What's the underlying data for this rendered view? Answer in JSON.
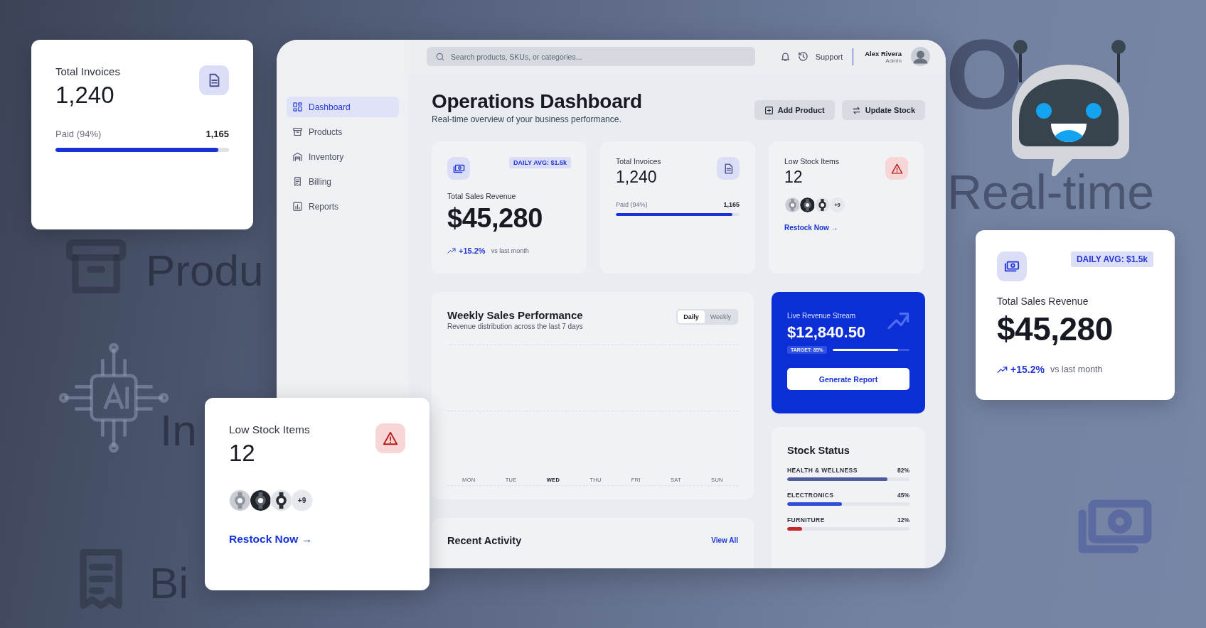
{
  "background_words": [
    {
      "text": "Produ"
    },
    {
      "text": "In"
    },
    {
      "text": "Bi"
    },
    {
      "text": "O"
    },
    {
      "text": "Real-time"
    }
  ],
  "dashboard": {
    "topbar": {
      "search": {
        "placeholder": "Search products, SKUs, or categories..."
      },
      "support": "Support",
      "user": {
        "name": "Alex Rivera",
        "role": "Admin"
      }
    },
    "sidebar": {
      "items": [
        {
          "label": "Dashboard",
          "selected": true
        },
        {
          "label": "Products",
          "selected": false
        },
        {
          "label": "Inventory",
          "selected": false
        },
        {
          "label": "Billing",
          "selected": false
        },
        {
          "label": "Reports",
          "selected": false
        }
      ]
    },
    "header": {
      "title": "Operations Dashboard",
      "subtitle": "Real-time overview of your business performance.",
      "actions": [
        {
          "label": "Add Product"
        },
        {
          "label": "Update Stock"
        }
      ]
    },
    "revenue": {
      "badge": "DAILY AVG: $1.5k",
      "label": "Total Sales Revenue",
      "value": "$45,280",
      "change": "+15.2%",
      "note": "vs last month"
    },
    "invoices": {
      "label": "Total Invoices",
      "value": "1,240",
      "paid_label": "Paid (94%)",
      "paid_value": "1,165",
      "level": 0.94
    },
    "low_stock": {
      "label": "Low Stock Items",
      "value": "12",
      "more": "+9",
      "link": "Restock Now →"
    },
    "weekly": {
      "title": "Weekly Sales Performance",
      "subtitle": "Revenue distribution across the last 7 days",
      "toggle": [
        {
          "label": "Daily",
          "selected": true
        },
        {
          "label": "Weekly",
          "selected": false
        }
      ],
      "days": [
        {
          "label": "MON",
          "selected": false
        },
        {
          "label": "TUE",
          "selected": false
        },
        {
          "label": "WED",
          "selected": true
        },
        {
          "label": "THU",
          "selected": false
        },
        {
          "label": "FRI",
          "selected": false
        },
        {
          "label": "SAT",
          "selected": false
        },
        {
          "label": "SUN",
          "selected": false
        }
      ]
    },
    "live": {
      "label": "Live Revenue Stream",
      "value": "$12,840.50",
      "target": "TARGET: 85%",
      "level": 0.85,
      "button": "Generate Report"
    },
    "recent": {
      "title": "Recent Activity",
      "link": "View All"
    },
    "stock_status": {
      "title": "Stock Status",
      "items": [
        {
          "name": "HEALTH & WELLNESS",
          "percent": "82%",
          "level": 0.82,
          "color": "#4e5b9c"
        },
        {
          "name": "ELECTRONICS",
          "percent": "45%",
          "level": 0.45,
          "color": "#2f4fd8"
        },
        {
          "name": "FURNITURE",
          "percent": "12%",
          "level": 0.12,
          "color": "#c62828"
        }
      ]
    }
  },
  "floating": {
    "invoices": {
      "label": "Total Invoices",
      "value": "1,240",
      "paid_label": "Paid (94%)",
      "paid_value": "1,165",
      "level": 0.94
    },
    "low_stock": {
      "label": "Low Stock Items",
      "value": "12",
      "more": "+9",
      "link": "Restock Now →"
    },
    "revenue": {
      "badge": "DAILY AVG: $1.5k",
      "label": "Total Sales Revenue",
      "value": "$45,280",
      "change": "+15.2%",
      "note": "vs last month"
    }
  }
}
